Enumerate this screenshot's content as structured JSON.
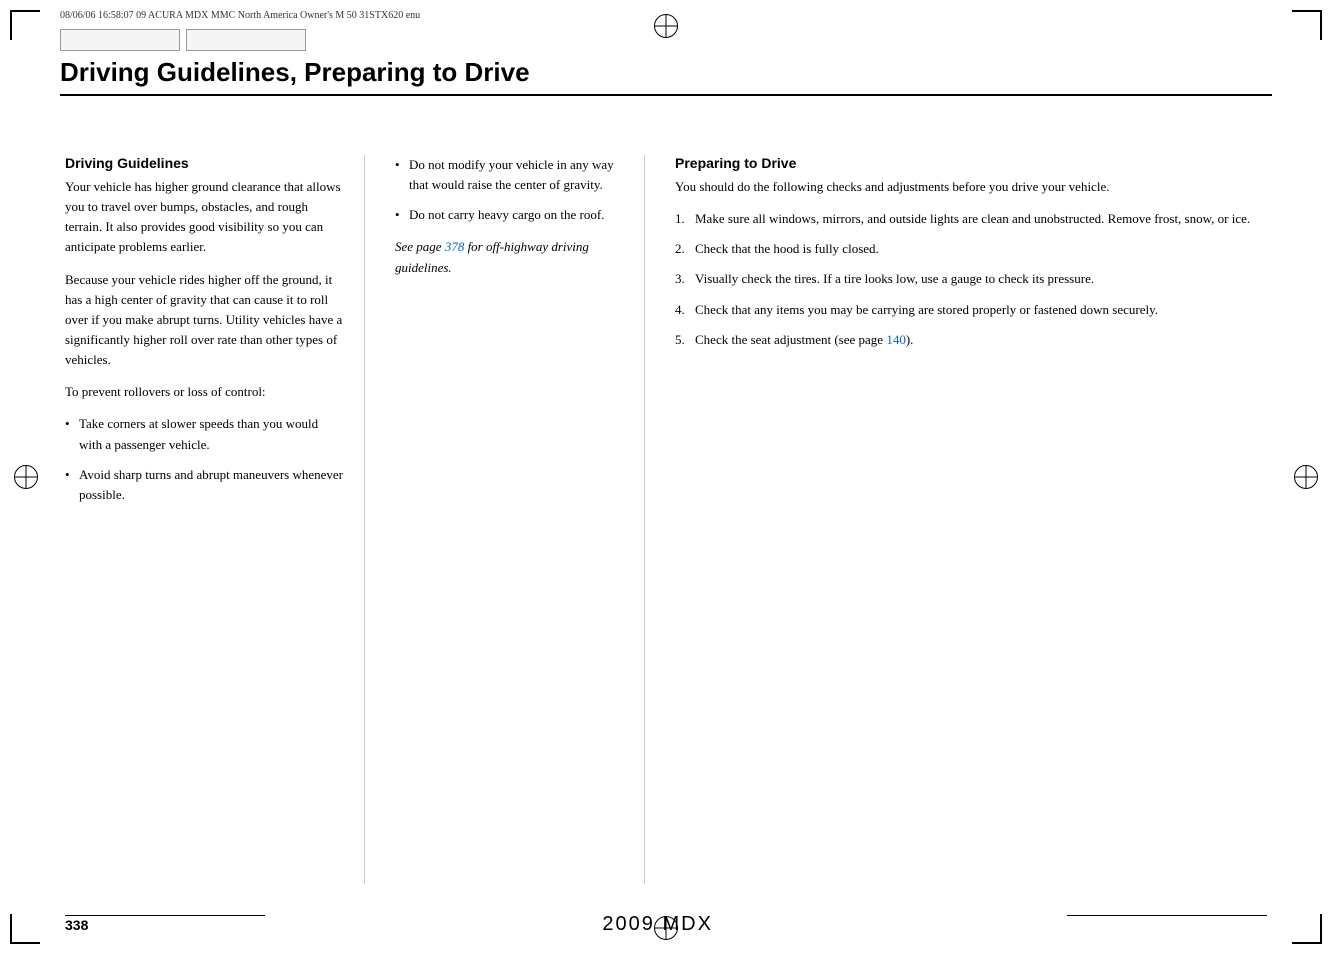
{
  "meta": {
    "print_info": "08/06/06  16:58:07    09 ACURA MDX MMC North America Owner's M 50 31STX620 enu"
  },
  "header": {
    "title": "Driving Guidelines, Preparing to Drive"
  },
  "col_left": {
    "heading": "Driving Guidelines",
    "para1": "Your vehicle has higher ground clearance that allows you to travel over bumps, obstacles, and rough terrain. It also provides good visibility so you can anticipate problems earlier.",
    "para2": "Because your vehicle rides higher off the ground, it has a high center of gravity that can cause it to roll over if you make abrupt turns. Utility vehicles have a significantly higher roll over rate than other types of vehicles.",
    "para3": "To prevent rollovers or loss of control:",
    "bullets": [
      "Take corners at slower speeds than you would with a passenger vehicle.",
      "Avoid sharp turns and abrupt maneuvers whenever possible."
    ]
  },
  "col_middle": {
    "bullets": [
      "Do not modify your vehicle in any way that would raise the center of gravity.",
      "Do not carry heavy cargo on the roof."
    ],
    "italic_text": "See page 378 for off-highway driving guidelines.",
    "link_page": "378"
  },
  "col_right": {
    "heading": "Preparing to Drive",
    "intro": "You should do the following checks and adjustments before you drive your vehicle.",
    "items": [
      {
        "num": "1.",
        "text": "Make sure all windows, mirrors, and outside lights are clean and unobstructed. Remove frost, snow, or ice."
      },
      {
        "num": "2.",
        "text": "Check that the hood is fully closed."
      },
      {
        "num": "3.",
        "text": "Visually check the tires. If a tire looks low, use a gauge to check its pressure."
      },
      {
        "num": "4.",
        "text": "Check that any items you may be carrying are stored properly or fastened down securely."
      },
      {
        "num": "5.",
        "text": "Check the seat adjustment (see page 140).",
        "link_page": "140"
      }
    ]
  },
  "footer": {
    "page_number": "338",
    "brand": "2009  MDX"
  }
}
